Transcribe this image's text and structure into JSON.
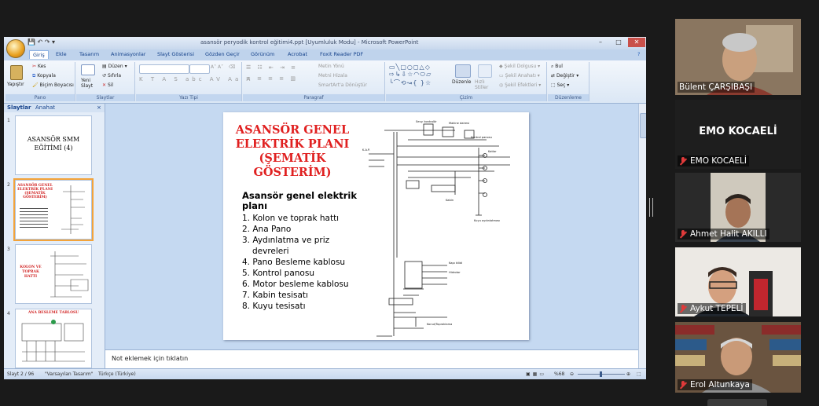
{
  "window": {
    "title": "asansör peryodik kontrol eğitimi4.ppt [Uyumluluk Modu] - Microsoft PowerPoint",
    "qat": "💾 ↶ ↷ ▾"
  },
  "ribbon": {
    "tabs": [
      "Giriş",
      "Ekle",
      "Tasarım",
      "Animasyonlar",
      "Slayt Gösterisi",
      "Gözden Geçir",
      "Görünüm",
      "Acrobat",
      "Foxit Reader PDF"
    ],
    "clipboard": {
      "paste": "Yapıştır",
      "cut": "Kes",
      "copy": "Kopyala",
      "format_painter": "Biçim Boyacısı",
      "label": "Pano"
    },
    "slides": {
      "new_slide": "Yeni Slayt",
      "layout": "Düzen",
      "reset": "Sıfırla",
      "delete": "Sil",
      "label": "Slaytlar"
    },
    "font": {
      "label": "Yazı Tipi"
    },
    "paragraph": {
      "text_direction": "Metin Yönü",
      "align_text": "Metni Hizala",
      "smartart": "SmartArt'a Dönüştür",
      "label": "Paragraf"
    },
    "drawing": {
      "arrange": "Düzenle",
      "quick_styles": "Hızlı Stiller",
      "shape_fill": "Şekil Dolgusu",
      "shape_outline": "Şekil Anahatı",
      "shape_effects": "Şekil Efektleri",
      "label": "Çizim"
    },
    "editing": {
      "find": "Bul",
      "replace": "Değiştir",
      "select": "Seç",
      "label": "Düzenleme"
    }
  },
  "slide_pane": {
    "tabs": [
      "Slaytlar",
      "Anahat"
    ],
    "thumbs": [
      {
        "num": "1",
        "text": "ASANSÖR SMM EĞİTİMİ (4)"
      },
      {
        "num": "2",
        "text": "ASANSÖR GENEL ELEKTRİK PLANI (ŞEMATİK GÖSTERİM)"
      },
      {
        "num": "3",
        "text": "KOLON VE TOPRAK HATTI"
      },
      {
        "num": "4",
        "text": "ANA BESLEME TABLOSU"
      }
    ]
  },
  "slide": {
    "title": "ASANSÖR GENEL ELEKTRİK PLANI (ŞEMATİK GÖSTERİM)",
    "heading": "Asansör genel elektrik planı",
    "items": [
      "1.  Kolon ve toprak hattı",
      "2.  Ana Pano",
      "3.  Aydınlatma ve priz devreleri",
      "4.  Pano Besleme kablosu",
      "5.  Kontrol panosu",
      "6.  Motor besleme kablosu",
      "7.  Kabin tesisatı",
      "8.  Kuyu tesisatı"
    ],
    "diagram_labels": {
      "l1": "Sevy. kontrolör",
      "l2": "Makine dairesi",
      "l3": "Kontrol panosu",
      "l4": "K.A.P.",
      "l5": "Kabin",
      "l6": "Katlar",
      "l7": "Kuyu aydınlatması",
      "l8": "Kapı kilidi",
      "l9": "Hidrotor",
      "l10": "Konut/Topraklama"
    }
  },
  "notes": {
    "placeholder": "Not eklemek için tıklatın"
  },
  "status": {
    "slide": "Slayt 2 / 96",
    "theme": "\"Varsayılan Tasarım\"",
    "language": "Türkçe (Türkiye)",
    "zoom": "%68"
  },
  "participants": [
    {
      "name": "Bülent ÇARŞIBAŞI",
      "muted": false,
      "active": true
    },
    {
      "name": "EMO KOCAELİ",
      "muted": true,
      "active": false,
      "center_text": "EMO KOCAELİ"
    },
    {
      "name": "Ahmet Halit AKILLI",
      "muted": true,
      "active": false
    },
    {
      "name": "Aykut TEPELİ",
      "muted": true,
      "active": false
    },
    {
      "name": "Erol Altunkaya",
      "muted": true,
      "active": false
    }
  ]
}
